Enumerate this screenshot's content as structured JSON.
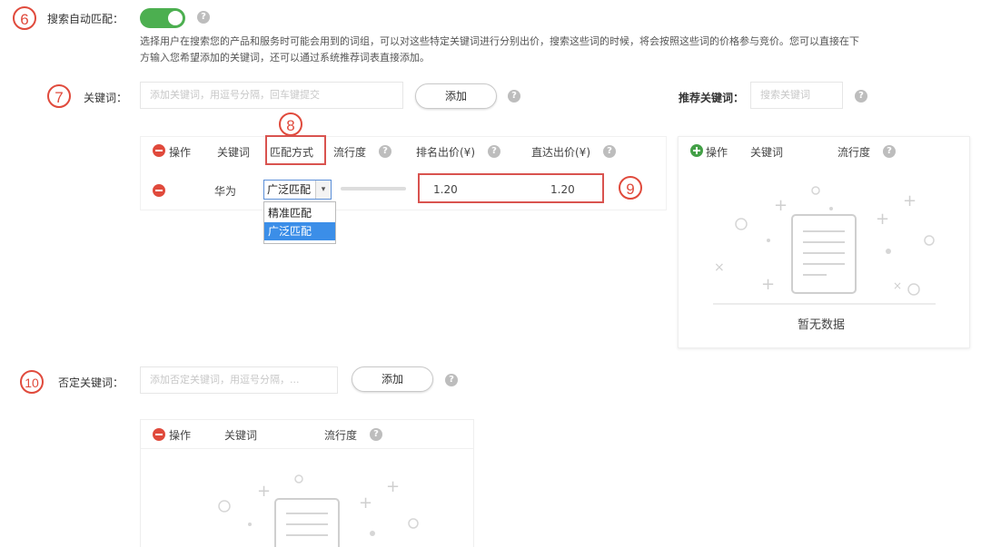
{
  "markers": {
    "m6": "6",
    "m7": "7",
    "m8": "8",
    "m9": "9",
    "m10": "10"
  },
  "auto_match": {
    "label": "搜索自动匹配：",
    "enabled": true,
    "description_line1": "选择用户在搜索您的产品和服务时可能会用到的词组，可以对这些特定关键词进行分别出价，搜索这些词的时候，将会按照这些词的价格参与竞价。您可以直接在下",
    "description_line2": "方输入您希望添加的关键词，还可以通过系统推荐词表直接添加。"
  },
  "keywords": {
    "label": "关键词：",
    "input_placeholder": "添加关键词，用逗号分隔，回车键提交",
    "add_button": "添加",
    "recommend_label": "推荐关键词：",
    "recommend_placeholder": "搜索关键词",
    "table": {
      "headers": {
        "op": "操作",
        "keyword": "关键词",
        "match": "匹配方式",
        "popularity": "流行度",
        "rank_bid": "排名出价(¥)",
        "direct_bid": "直达出价(¥)"
      },
      "rows": [
        {
          "keyword": "华为",
          "match": "广泛匹配",
          "rank_bid": "1.20",
          "direct_bid": "1.20"
        }
      ],
      "match_options": [
        "精准匹配",
        "广泛匹配"
      ]
    },
    "recommend_table": {
      "op": "操作",
      "keyword": "关键词",
      "popularity": "流行度",
      "empty": "暂无数据"
    }
  },
  "negative": {
    "label": "否定关键词：",
    "input_placeholder": "添加否定关键词，用逗号分隔，...",
    "add_button": "添加",
    "table": {
      "op": "操作",
      "keyword": "关键词",
      "popularity": "流行度"
    }
  }
}
